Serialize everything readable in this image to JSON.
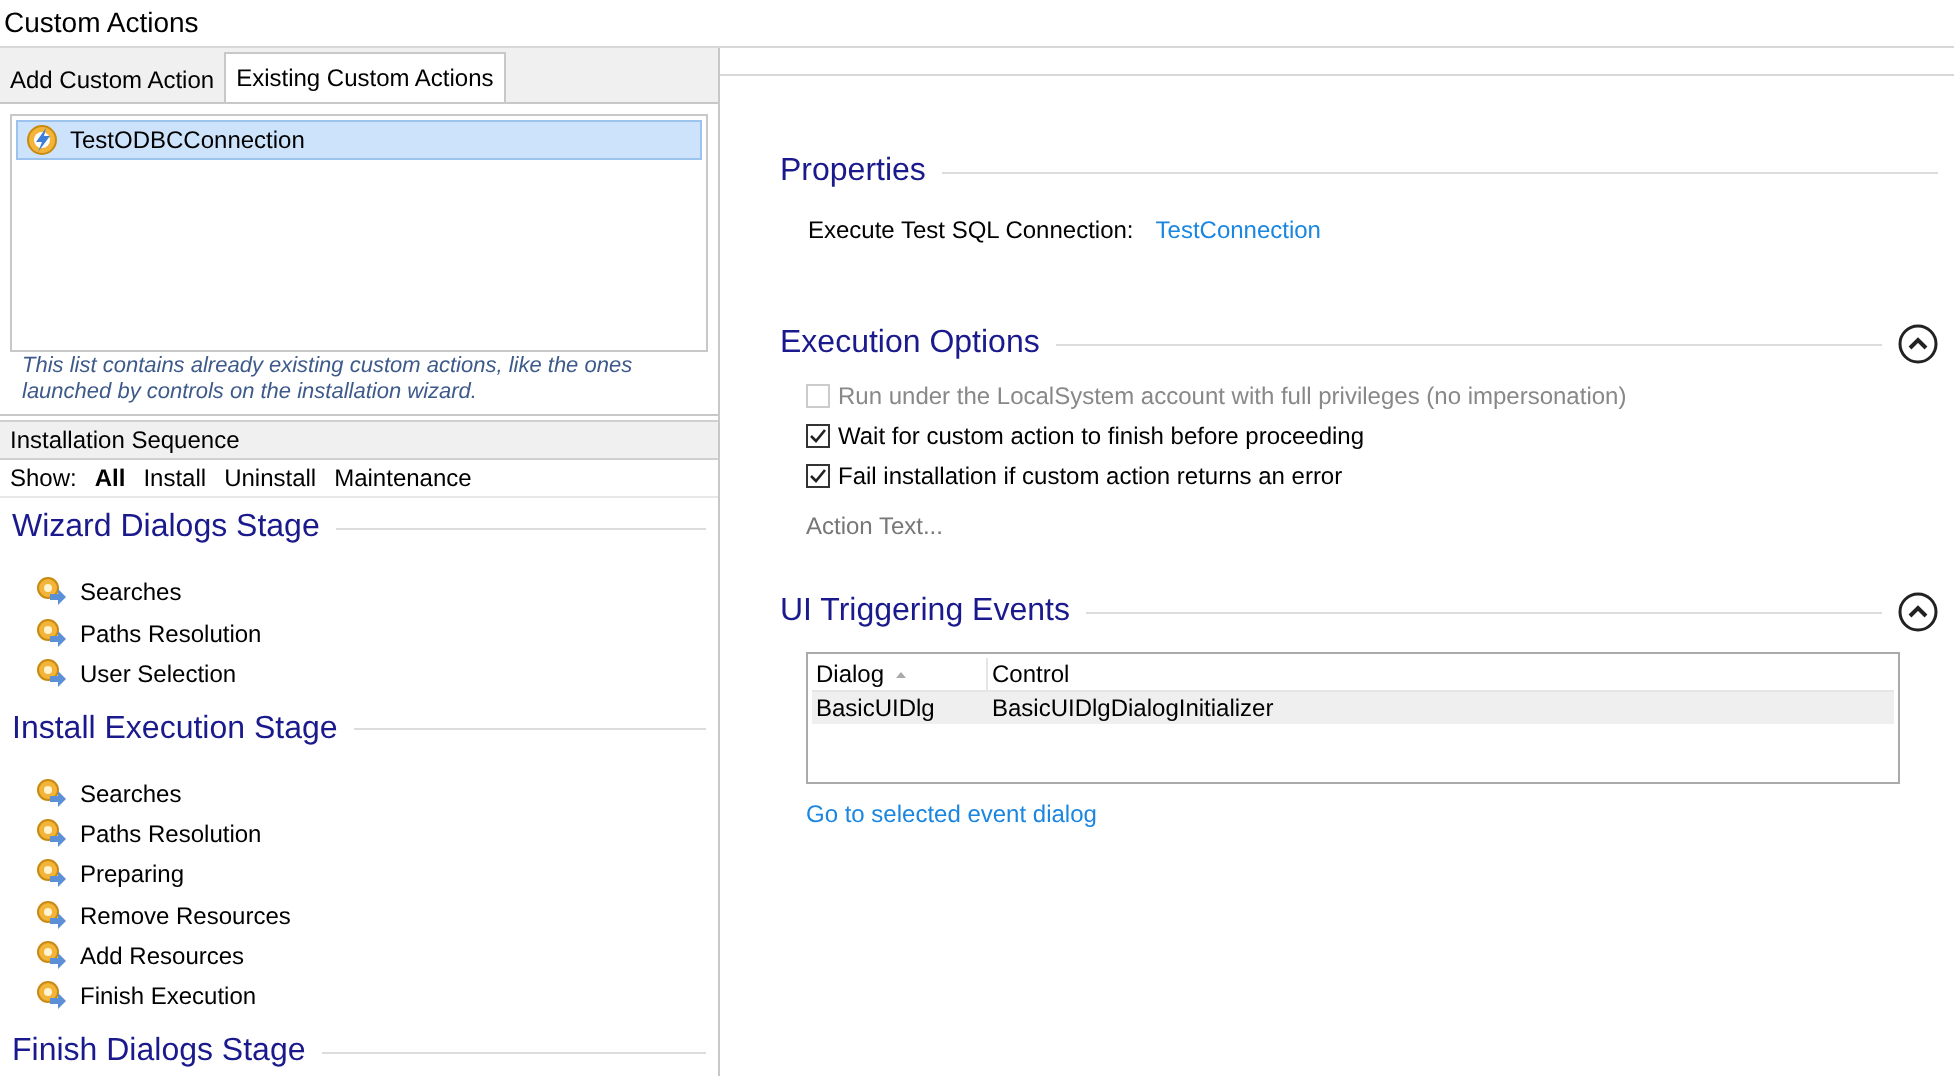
{
  "window": {
    "title": "Custom Actions"
  },
  "tabs": [
    {
      "label": "Add Custom Action",
      "selected": false
    },
    {
      "label": "Existing Custom Actions",
      "selected": true
    }
  ],
  "actions_list": {
    "items": [
      {
        "label": "TestODBCConnection",
        "selected": true
      }
    ],
    "hint": "This list contains already existing custom actions, like the ones launched by controls on the installation wizard."
  },
  "installation_sequence": {
    "title": "Installation Sequence",
    "show_label": "Show:",
    "filters": [
      {
        "label": "All",
        "selected": true
      },
      {
        "label": "Install",
        "selected": false
      },
      {
        "label": "Uninstall",
        "selected": false
      },
      {
        "label": "Maintenance",
        "selected": false
      }
    ],
    "stages": [
      {
        "title": "Wizard Dialogs Stage",
        "items": [
          "Searches",
          "Paths Resolution",
          "User Selection"
        ]
      },
      {
        "title": "Install Execution Stage",
        "items": [
          "Searches",
          "Paths Resolution",
          "Preparing",
          "Remove Resources",
          "Add Resources",
          "Finish Execution"
        ]
      },
      {
        "title": "Finish Dialogs Stage"
      }
    ]
  },
  "properties": {
    "title": "Properties",
    "label": "Execute Test SQL Connection:",
    "value": "TestConnection"
  },
  "execution_options": {
    "title": "Execution Options",
    "expanded": true,
    "options": [
      {
        "label": "Run under the LocalSystem account with full privileges (no impersonation)",
        "checked": false,
        "disabled": true
      },
      {
        "label": "Wait for custom action to finish before proceeding",
        "checked": true,
        "disabled": false
      },
      {
        "label": "Fail installation if custom action returns an error",
        "checked": true,
        "disabled": false
      }
    ],
    "action_text": "Action Text..."
  },
  "ui_triggering_events": {
    "title": "UI Triggering Events",
    "expanded": true,
    "table": {
      "columns": [
        "Dialog",
        "Control"
      ],
      "rows": [
        {
          "cells": [
            "BasicUIDlg",
            "BasicUIDlgDialogInitializer"
          ],
          "selected": true
        }
      ]
    },
    "link": "Go to selected event dialog"
  }
}
